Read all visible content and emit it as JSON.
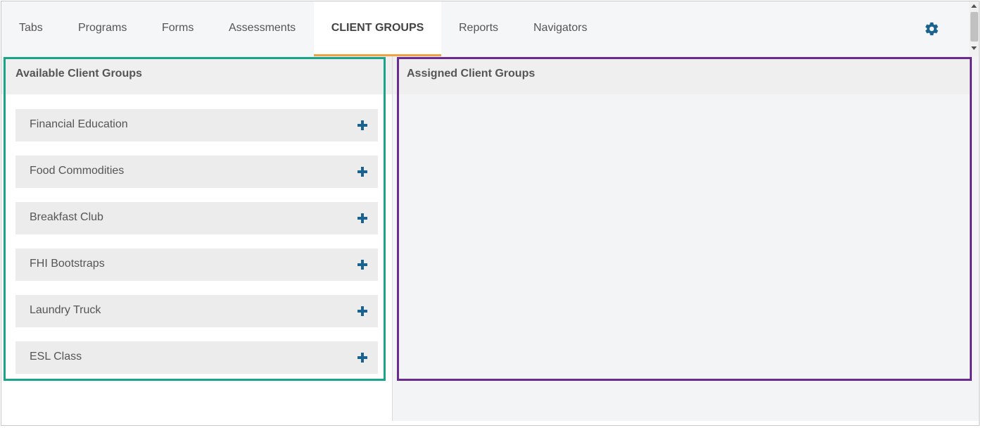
{
  "tabs": [
    {
      "label": "Tabs",
      "active": false
    },
    {
      "label": "Programs",
      "active": false
    },
    {
      "label": "Forms",
      "active": false
    },
    {
      "label": "Assessments",
      "active": false
    },
    {
      "label": "CLIENT GROUPS",
      "active": true
    },
    {
      "label": "Reports",
      "active": false
    },
    {
      "label": "Navigators",
      "active": false
    }
  ],
  "settings_icon": "gear-icon",
  "available": {
    "title": "Available Client Groups",
    "items": [
      {
        "label": "Financial Education",
        "icon": "plus-icon"
      },
      {
        "label": "Food Commodities",
        "icon": "plus-icon"
      },
      {
        "label": "Breakfast Club",
        "icon": "plus-icon"
      },
      {
        "label": "FHI Bootstraps",
        "icon": "plus-icon"
      },
      {
        "label": "Laundry Truck",
        "icon": "plus-icon"
      },
      {
        "label": "ESL Class",
        "icon": "plus-icon"
      }
    ]
  },
  "assigned": {
    "title": "Assigned Client Groups",
    "items": []
  },
  "colors": {
    "accent_tab_underline": "#f0a242",
    "icon_blue": "#1a6391",
    "highlight_available": "#1aa58a",
    "highlight_assigned": "#6a2b90"
  }
}
